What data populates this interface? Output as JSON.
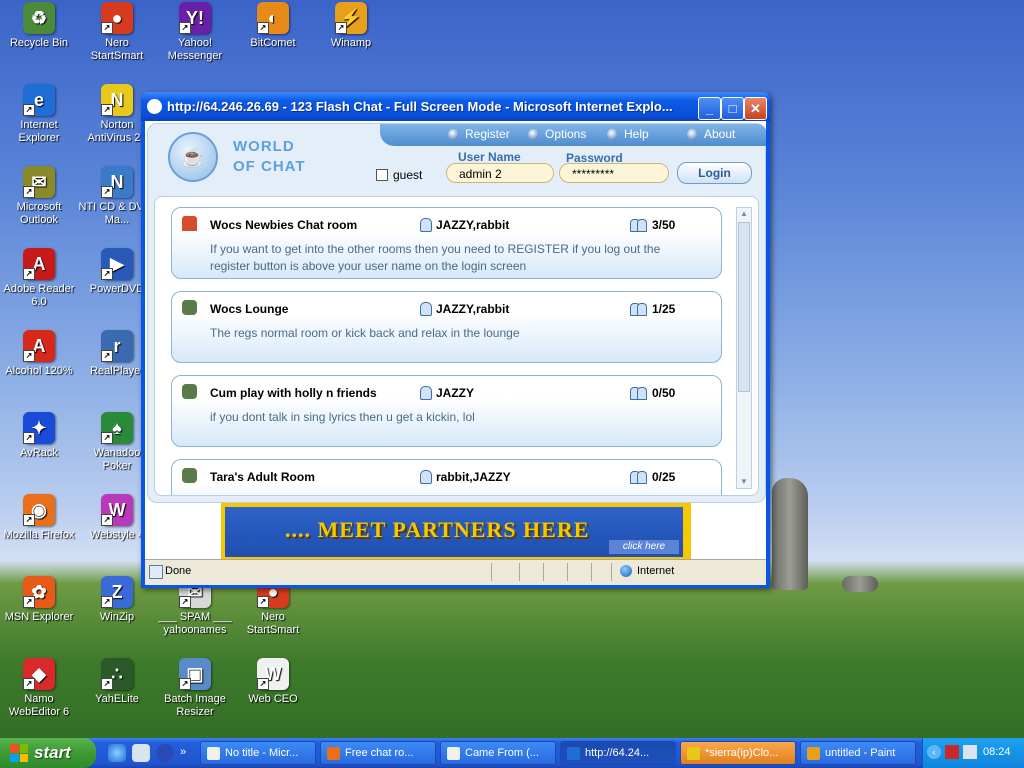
{
  "desktop": {
    "icons": [
      {
        "label": "Recycle Bin",
        "glyph": "♻",
        "color": "#4a8a3a"
      },
      {
        "label": "Nero StartSmart",
        "glyph": "●",
        "color": "#d83a1f"
      },
      {
        "label": "Yahoo! Messenger",
        "glyph": "Y!",
        "color": "#6a1fa8"
      },
      {
        "label": "BitComet",
        "glyph": "◐",
        "color": "#e88a1a"
      },
      {
        "label": "Winamp",
        "glyph": "⚡",
        "color": "#e8a01a"
      },
      {
        "label": "Internet Explorer",
        "glyph": "e",
        "color": "#1f6ed8"
      },
      {
        "label": "Norton AntiVirus 20",
        "glyph": "N",
        "color": "#e8c81a"
      },
      {
        "label": "Microsoft Outlook",
        "glyph": "✉",
        "color": "#8a8a2a"
      },
      {
        "label": "NTI CD & DVD-Ma...",
        "glyph": "N",
        "color": "#3a7ac8"
      },
      {
        "label": "Adobe Reader 6.0",
        "glyph": "A",
        "color": "#c81a1a"
      },
      {
        "label": "PowerDVD",
        "glyph": "▶",
        "color": "#2a5ab8"
      },
      {
        "label": "Alcohol 120%",
        "glyph": "A",
        "color": "#d8281a"
      },
      {
        "label": "RealPlayer",
        "glyph": "r",
        "color": "#3a6ab0"
      },
      {
        "label": "AvRack",
        "glyph": "✦",
        "color": "#1a4ad8"
      },
      {
        "label": "Wanadoo Poker",
        "glyph": "♠",
        "color": "#2a8a3a"
      },
      {
        "label": "Mozilla Firefox",
        "glyph": "◉",
        "color": "#e8701a"
      },
      {
        "label": "Webstyle 4",
        "glyph": "W",
        "color": "#b83ab8"
      },
      {
        "label": "MSN Explorer",
        "glyph": "✿",
        "color": "#e85a1a"
      },
      {
        "label": "WinZip",
        "glyph": "Z",
        "color": "#3a6ad8"
      },
      {
        "label": "___ SPAM ___ yahoonames",
        "glyph": "✉",
        "color": "#d8d8d8"
      },
      {
        "label": "Nero StartSmart",
        "glyph": "●",
        "color": "#d83a1f"
      },
      {
        "label": "Namo WebEditor 6",
        "glyph": "◆",
        "color": "#d82a2a"
      },
      {
        "label": "YahELite",
        "glyph": "∴",
        "color": "#2a5a2a"
      },
      {
        "label": "Batch Image Resizer",
        "glyph": "▣",
        "color": "#5a8ac8"
      },
      {
        "label": "Web CEO",
        "glyph": "W",
        "color": "#f0f0f0"
      }
    ]
  },
  "window": {
    "title": "http://64.246.26.69 - 123 Flash Chat - Full Screen Mode - Microsoft Internet Explo...",
    "minimize_label": "_",
    "maximize_label": "□",
    "close_label": "✕",
    "status_text": "Done",
    "zone_text": "Internet"
  },
  "chat": {
    "logo_line1": "WORLD",
    "logo_line2": "OF CHAT",
    "nav": [
      "Register",
      "Options",
      "Help",
      "About"
    ],
    "guest_label": "guest",
    "username_label": "User Name",
    "password_label": "Password",
    "username_value": "admin 2",
    "password_value": "*********",
    "login_label": "Login",
    "rooms": [
      {
        "name": "Wocs Newbies Chat room",
        "users": "JAZZY,rabbit",
        "count": "3/50",
        "desc": "If you want to get into the other rooms then you need to REGISTER if you log out the register button is above your user name on the login screen",
        "icon": "home"
      },
      {
        "name": "Wocs Lounge",
        "users": "JAZZY,rabbit",
        "count": "1/25",
        "desc": "The regs normal room or kick back and relax in the lounge",
        "icon": "lock"
      },
      {
        "name": "Cum play with holly n friends",
        "users": "JAZZY",
        "count": "0/50",
        "desc": "if you dont talk in sing lyrics then u get a kickin, lol",
        "icon": "lock"
      },
      {
        "name": "Tara's Adult Room",
        "users": "rabbit,JAZZY",
        "count": "0/25",
        "desc": "",
        "icon": "lock"
      }
    ],
    "banner_text": ".... MEET PARTNERS HERE",
    "banner_click": "click here"
  },
  "taskbar": {
    "start_label": "start",
    "tasks": [
      {
        "label": "No title - Micr...",
        "color": "#f0f0f0"
      },
      {
        "label": "Free chat ro...",
        "color": "#e8701a"
      },
      {
        "label": "Came From (...",
        "color": "#f0f0f0"
      },
      {
        "label": "http://64.24...",
        "color": "#1f6ed8"
      },
      {
        "label": "*sierra(ip)Clo...",
        "color": "#e8c81a"
      },
      {
        "label": "untitled - Paint",
        "color": "#e8a01a"
      }
    ],
    "clock": "08:24"
  }
}
